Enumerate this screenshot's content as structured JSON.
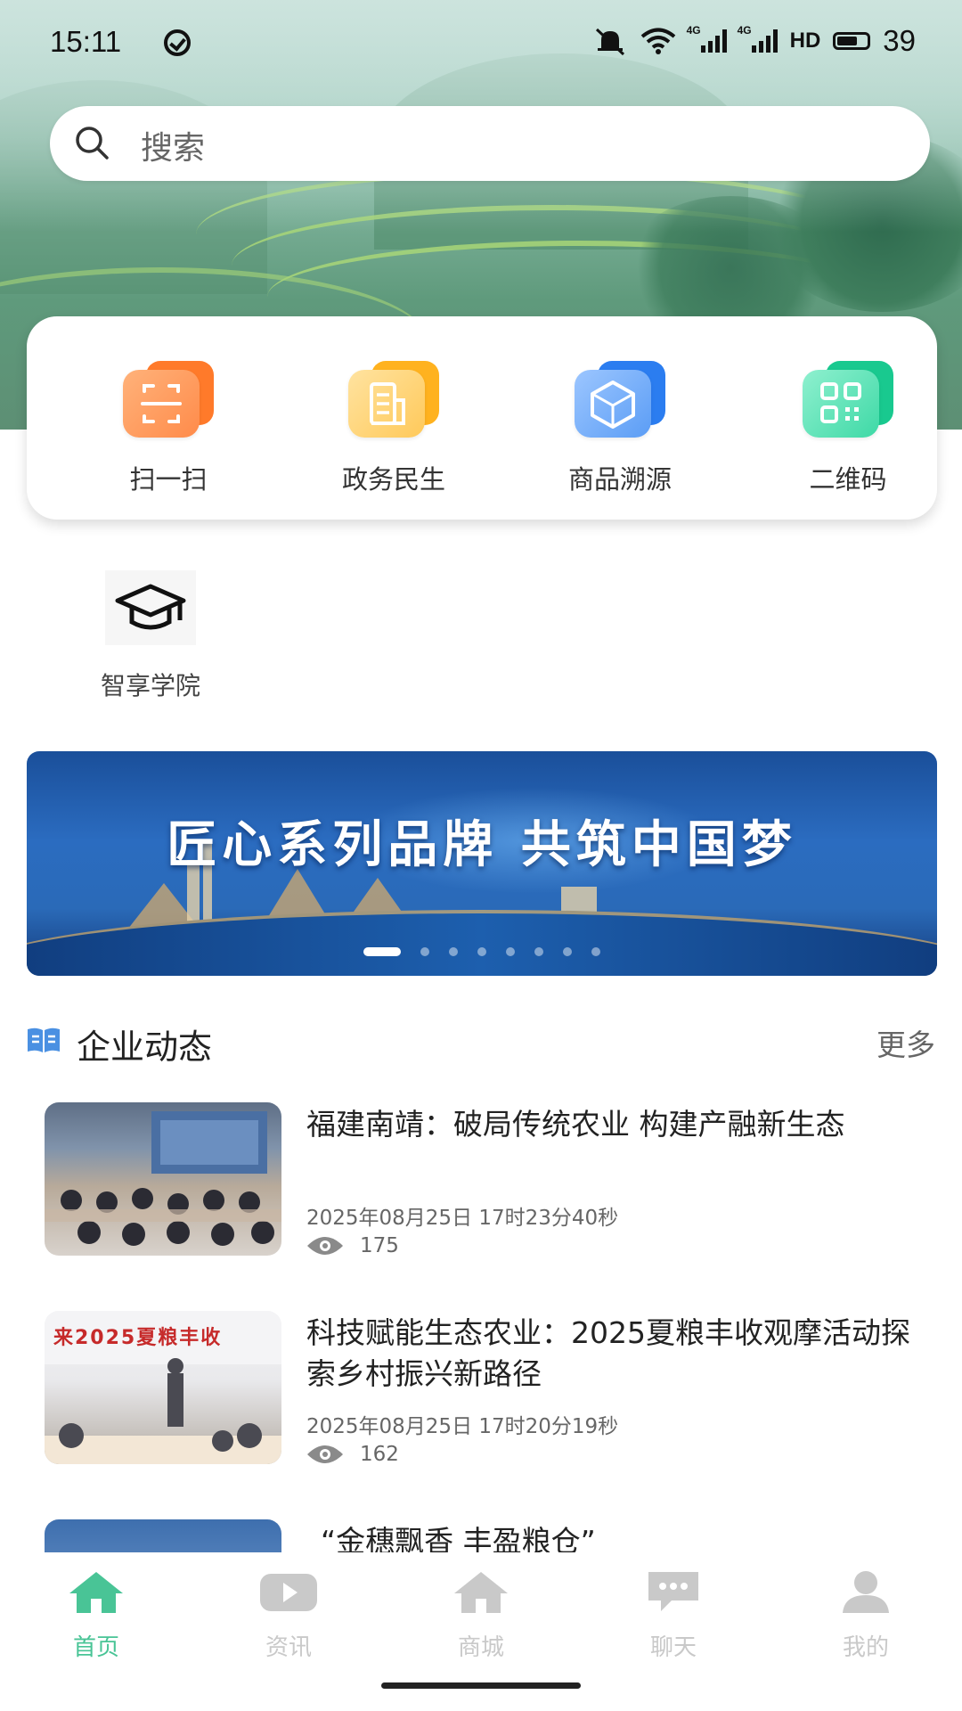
{
  "status_bar": {
    "time": "15:11",
    "network_label_1": "4G",
    "network_label_2": "4G",
    "hd_label": "HD",
    "battery": "39"
  },
  "search": {
    "placeholder": "搜索"
  },
  "quick_actions": [
    {
      "label": "扫一扫",
      "icon": "scan-icon",
      "color": "#ff8a3d"
    },
    {
      "label": "政务民生",
      "icon": "document-icon",
      "color": "#ffc533"
    },
    {
      "label": "商品溯源",
      "icon": "cube-icon",
      "color": "#3f8ff5"
    },
    {
      "label": "二维码",
      "icon": "qrcode-icon",
      "color": "#2fd3a2"
    }
  ],
  "academy": {
    "label": "智享学院",
    "icon": "graduation-cap-icon"
  },
  "banner": {
    "title": "匠心系列品牌 共筑中国梦",
    "slide_count": 8,
    "active_slide": 1
  },
  "section": {
    "title": "企业动态",
    "more_label": "更多",
    "icon": "book-icon",
    "accent": "#4a90e2"
  },
  "news": [
    {
      "title": "福建南靖：破局传统农业 构建产融新生态",
      "date": "2025年08月25日 17时23分40秒",
      "views": "175"
    },
    {
      "title": "科技赋能生态农业：2025夏粮丰收观摩活动探索乡村振兴新路径",
      "date": "2025年08月25日 17时20分19秒",
      "views": "162",
      "thumb_caption": "来2025夏粮丰收"
    },
    {
      "title": "“金穗飘香 丰盈粮仓”"
    }
  ],
  "tabs": [
    {
      "label": "首页",
      "icon": "home-icon",
      "active": true
    },
    {
      "label": "资讯",
      "icon": "video-play-icon",
      "active": false
    },
    {
      "label": "商城",
      "icon": "store-icon",
      "active": false
    },
    {
      "label": "聊天",
      "icon": "chat-bubble-icon",
      "active": false
    },
    {
      "label": "我的",
      "icon": "user-icon",
      "active": false
    }
  ],
  "colors": {
    "active_tab": "#49c496",
    "inactive_tab": "#c9c9c9"
  }
}
